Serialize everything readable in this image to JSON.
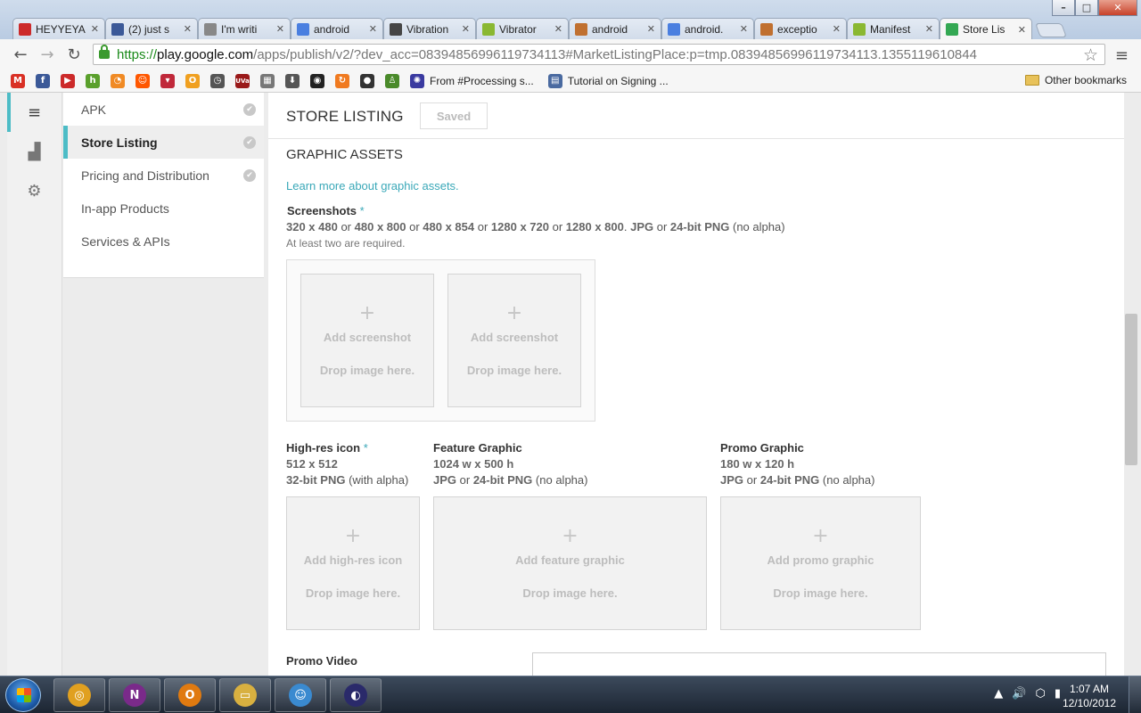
{
  "browser": {
    "tabs": [
      {
        "title": "HEYYEYA",
        "icon": "youtube-icon",
        "color": "#cc2a2a"
      },
      {
        "title": "(2) just s",
        "icon": "facebook-icon",
        "color": "#3b5998"
      },
      {
        "title": "I'm writi",
        "icon": "reddit-icon",
        "color": "#888888"
      },
      {
        "title": "android",
        "icon": "google-icon",
        "color": "#4a7fe0"
      },
      {
        "title": "Vibration",
        "icon": "wordpress-icon",
        "color": "#464646"
      },
      {
        "title": "Vibrator",
        "icon": "android-icon",
        "color": "#8ab832"
      },
      {
        "title": "android",
        "icon": "stackoverflow-icon",
        "color": "#c07030"
      },
      {
        "title": "android.",
        "icon": "google-icon",
        "color": "#4a7fe0"
      },
      {
        "title": "exceptio",
        "icon": "stackoverflow-icon",
        "color": "#c07030"
      },
      {
        "title": "Manifest",
        "icon": "android-icon",
        "color": "#8ab832"
      },
      {
        "title": "Store Lis",
        "icon": "google-play-icon",
        "color": "#34a853",
        "active": true
      }
    ],
    "close_glyph": "✕",
    "window": {
      "minimize": "–",
      "maximize": "□",
      "close": "✕"
    },
    "url": {
      "scheme": "https://",
      "host": "play.google.com",
      "path": "/apps/publish/v2/?dev_acc=08394856996119734113#MarketListingPlace:p=tmp.08394856996119734113.1355119610844"
    },
    "nav": {
      "back": "←",
      "forward": "→",
      "reload": "↻",
      "star": "☆",
      "menu": "≡"
    },
    "bookmarks": {
      "icons": [
        {
          "name": "gmail-icon",
          "glyph": "M",
          "color": "#d93025"
        },
        {
          "name": "facebook-icon",
          "glyph": "f",
          "color": "#3b5998"
        },
        {
          "name": "youtube-icon",
          "glyph": "▶",
          "color": "#cc2a2a"
        },
        {
          "name": "houzz-icon",
          "glyph": "h",
          "color": "#5aa02c"
        },
        {
          "name": "rss-icon",
          "glyph": "◔",
          "color": "#f08a24"
        },
        {
          "name": "reddit-icon",
          "glyph": "☺",
          "color": "#ff5700"
        },
        {
          "name": "pocket-icon",
          "glyph": "▾",
          "color": "#c0283a"
        },
        {
          "name": "orange-app-icon",
          "glyph": "O",
          "color": "#f0a020"
        },
        {
          "name": "clock-icon",
          "glyph": "◷",
          "color": "#555555"
        },
        {
          "name": "uva-icon",
          "glyph": "UVa",
          "color": "#9a1a1a"
        },
        {
          "name": "tiles-icon",
          "glyph": "▦",
          "color": "#777777"
        },
        {
          "name": "download-icon",
          "glyph": "⬇",
          "color": "#555555"
        },
        {
          "name": "cat-icon",
          "glyph": "◉",
          "color": "#222222"
        },
        {
          "name": "swirl-icon",
          "glyph": "↻",
          "color": "#f07a20"
        },
        {
          "name": "github-icon",
          "glyph": "●",
          "color": "#333333"
        },
        {
          "name": "figure-icon",
          "glyph": "♙",
          "color": "#4a8a2a"
        }
      ],
      "links": [
        {
          "label": "From #Processing s...",
          "icon": "processing-icon",
          "glyph": "✺",
          "color": "#3a3aa0"
        },
        {
          "label": "Tutorial on Signing ...",
          "icon": "page-icon",
          "glyph": "▤",
          "color": "#4a6aa0"
        }
      ],
      "other": "Other bookmarks"
    }
  },
  "console": {
    "rail": [
      {
        "name": "menu-icon",
        "glyph": "≡",
        "active": true
      },
      {
        "name": "stats-icon",
        "glyph": "▟"
      },
      {
        "name": "settings-icon",
        "glyph": "⚙"
      }
    ],
    "sidebar": [
      {
        "label": "APK",
        "checked": true
      },
      {
        "label": "Store Listing",
        "checked": true,
        "active": true
      },
      {
        "label": "Pricing and Distribution",
        "checked": true
      },
      {
        "label": "In-app Products",
        "checked": false
      },
      {
        "label": "Services & APIs",
        "checked": false
      }
    ],
    "check_glyph": "✔",
    "header": {
      "title": "STORE LISTING",
      "saved": "Saved"
    },
    "section": {
      "title": "GRAPHIC ASSETS",
      "learn_more": "Learn more about graphic assets."
    },
    "screenshots": {
      "label": "Screenshots",
      "required_mark": "*",
      "sizes": [
        "320 x 480",
        "480 x 800",
        "480 x 854",
        "1280 x 720",
        "1280 x 800"
      ],
      "or": "or",
      "formats": {
        "jpg": "JPG",
        "png": "24-bit PNG",
        "note": "(no alpha)"
      },
      "hint": "At least two are required.",
      "slots": [
        {
          "add": "Add screenshot",
          "drop": "Drop image here."
        },
        {
          "add": "Add screenshot",
          "drop": "Drop image here."
        }
      ]
    },
    "hires_icon": {
      "label": "High-res icon",
      "required_mark": "*",
      "size": "512 x 512",
      "format": "32-bit PNG",
      "format_note": "(with alpha)",
      "add": "Add high-res icon",
      "drop": "Drop image here."
    },
    "feature_graphic": {
      "label": "Feature Graphic",
      "size": "1024 w x 500 h",
      "jpg": "JPG",
      "or": "or",
      "png": "24-bit PNG",
      "note": "(no alpha)",
      "add": "Add feature graphic",
      "drop": "Drop image here."
    },
    "promo_graphic": {
      "label": "Promo Graphic",
      "size": "180 w x 120 h",
      "jpg": "JPG",
      "or": "or",
      "png": "24-bit PNG",
      "note": "(no alpha)",
      "add": "Add promo graphic",
      "drop": "Drop image here."
    },
    "promo_video": {
      "label": "Promo Video"
    },
    "plus_glyph": "+"
  },
  "taskbar": {
    "apps": [
      {
        "name": "chrome-icon",
        "glyph": "◎",
        "color": "#e0a020"
      },
      {
        "name": "onenote-icon",
        "glyph": "N",
        "color": "#7a2a8a"
      },
      {
        "name": "outlook-icon",
        "glyph": "O",
        "color": "#e07a10"
      },
      {
        "name": "explorer-icon",
        "glyph": "▭",
        "color": "#d8b040"
      },
      {
        "name": "cat-app-icon",
        "glyph": "☺",
        "color": "#3a8ad0"
      },
      {
        "name": "eclipse-icon",
        "glyph": "◐",
        "color": "#2a2a6a"
      }
    ],
    "tray": [
      "▲",
      "🔊",
      "⬡",
      "▮"
    ],
    "time": "1:07 AM",
    "date": "12/10/2012"
  }
}
